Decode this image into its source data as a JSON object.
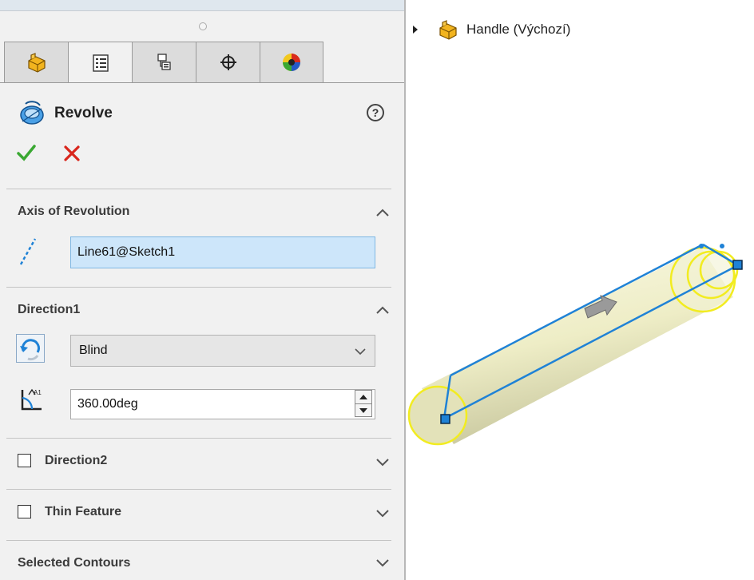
{
  "property_manager": {
    "tabs": [
      {
        "icon": "part-icon"
      },
      {
        "icon": "property-manager-icon"
      },
      {
        "icon": "configuration-manager-icon"
      },
      {
        "icon": "dimxpert-icon"
      },
      {
        "icon": "display-manager-icon"
      }
    ],
    "title": "Revolve",
    "help": "?",
    "sections": {
      "axis": {
        "title": "Axis of Revolution",
        "value": "Line61@Sketch1"
      },
      "direction1": {
        "title": "Direction1",
        "type": "Blind",
        "angle": "360.00deg"
      },
      "direction2": {
        "title": "Direction2",
        "checked": false
      },
      "thin_feature": {
        "title": "Thin Feature",
        "checked": false
      },
      "selected_contours": {
        "title": "Selected Contours"
      }
    }
  },
  "feature_tree": {
    "part_name": "Handle  (Výchozí)"
  },
  "colors": {
    "accent_blue": "#1f82d6",
    "ok_green": "#3aa832",
    "cancel_red": "#d9261c",
    "selection_yellow": "#f2ec20"
  }
}
